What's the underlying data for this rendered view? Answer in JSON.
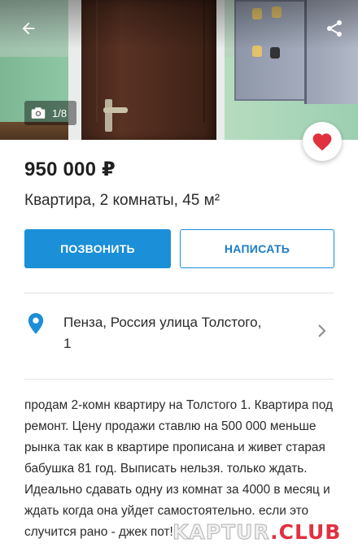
{
  "gallery": {
    "counter": "1/8"
  },
  "listing": {
    "price": "950 000 ₽",
    "title": "Квартира, 2 комнаты, 45 м²"
  },
  "actions": {
    "call_label": "ПОЗВОНИТЬ",
    "write_label": "НАПИСАТЬ"
  },
  "location": {
    "address_line1": "Пенза, Россия улица Толстого,",
    "address_line2": "1"
  },
  "description": {
    "text": "продам 2-комн квартиру на Толстого 1. Квартира под ремонт. Цену продажи ставлю на 500 000 меньше рынка так как в квартире прописана и живет старая бабушка 81 год. Выписать нельзя. только ждать. Идеально сдавать одну из комнат за 4000 в месяц и ждать когда она уйдет самостоятельно. если это случится рано - джек пот!"
  },
  "watermark": {
    "brand": "KAPTUR",
    "dot": ".",
    "suffix": "CLUB"
  },
  "colors": {
    "accent": "#1b8fd8",
    "favorite": "#e0313f",
    "pin": "#1b8fd8"
  },
  "icons": {
    "back": "arrow-left-icon",
    "share": "share-icon",
    "camera": "camera-icon",
    "favorite": "heart-icon",
    "location": "map-pin-icon",
    "chevron": "chevron-right-icon"
  }
}
